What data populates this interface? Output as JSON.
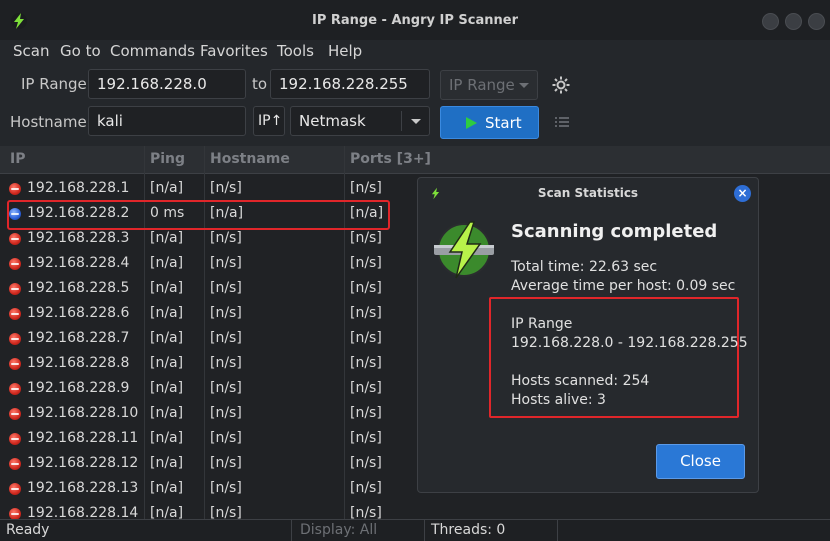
{
  "window": {
    "title": "IP Range - Angry IP Scanner"
  },
  "menu": [
    "Scan",
    "Go to",
    "Commands",
    "Favorites",
    "Tools",
    "Help"
  ],
  "toolbar": {
    "ip_range_label": "IP Range:",
    "ip_from": "192.168.228.0",
    "to_label": "to",
    "ip_to": "192.168.228.255",
    "feeder_select": "IP Range",
    "hostname_label": "Hostname:",
    "hostname": "kali",
    "ip_up_button": "IP↑",
    "netmask_select": "Netmask",
    "start_label": "Start"
  },
  "table": {
    "columns": [
      "IP",
      "Ping",
      "Hostname",
      "Ports [3+]"
    ],
    "rows": [
      {
        "status": "dead",
        "ip": "192.168.228.1",
        "ping": "[n/a]",
        "hostname": "[n/s]",
        "ports": "[n/s]"
      },
      {
        "status": "alive",
        "ip": "192.168.228.2",
        "ping": "0 ms",
        "hostname": "[n/a]",
        "ports": "[n/a]"
      },
      {
        "status": "dead",
        "ip": "192.168.228.3",
        "ping": "[n/a]",
        "hostname": "[n/s]",
        "ports": "[n/s]"
      },
      {
        "status": "dead",
        "ip": "192.168.228.4",
        "ping": "[n/a]",
        "hostname": "[n/s]",
        "ports": "[n/s]"
      },
      {
        "status": "dead",
        "ip": "192.168.228.5",
        "ping": "[n/a]",
        "hostname": "[n/s]",
        "ports": "[n/s]"
      },
      {
        "status": "dead",
        "ip": "192.168.228.6",
        "ping": "[n/a]",
        "hostname": "[n/s]",
        "ports": "[n/s]"
      },
      {
        "status": "dead",
        "ip": "192.168.228.7",
        "ping": "[n/a]",
        "hostname": "[n/s]",
        "ports": "[n/s]"
      },
      {
        "status": "dead",
        "ip": "192.168.228.8",
        "ping": "[n/a]",
        "hostname": "[n/s]",
        "ports": "[n/s]"
      },
      {
        "status": "dead",
        "ip": "192.168.228.9",
        "ping": "[n/a]",
        "hostname": "[n/s]",
        "ports": "[n/s]"
      },
      {
        "status": "dead",
        "ip": "192.168.228.10",
        "ping": "[n/a]",
        "hostname": "[n/s]",
        "ports": "[n/s]"
      },
      {
        "status": "dead",
        "ip": "192.168.228.11",
        "ping": "[n/a]",
        "hostname": "[n/s]",
        "ports": "[n/s]"
      },
      {
        "status": "dead",
        "ip": "192.168.228.12",
        "ping": "[n/a]",
        "hostname": "[n/s]",
        "ports": "[n/s]"
      },
      {
        "status": "dead",
        "ip": "192.168.228.13",
        "ping": "[n/a]",
        "hostname": "[n/s]",
        "ports": "[n/s]"
      },
      {
        "status": "dead",
        "ip": "192.168.228.14",
        "ping": "[n/a]",
        "hostname": "[n/s]",
        "ports": "[n/s]"
      }
    ]
  },
  "statusbar": {
    "status": "Ready",
    "display": "Display: All",
    "threads": "Threads: 0"
  },
  "dialog": {
    "title": "Scan Statistics",
    "heading": "Scanning completed",
    "total_time": "Total time: 22.63 sec",
    "avg_time": "Average time per host: 0.09 sec",
    "range_label": "IP Range",
    "range_value": "192.168.228.0 - 192.168.228.255",
    "hosts_scanned": "Hosts scanned: 254",
    "hosts_alive": "Hosts alive: 3",
    "close_label": "Close"
  },
  "colors": {
    "accent": "#1f6fc4",
    "highlight": "#e0262a",
    "alive": "#2b5fd9",
    "dead": "#d0281e",
    "logo_green": "#7ee03a"
  },
  "icons": {
    "app": "lightning-bolt-icon",
    "settings": "gear-icon",
    "prefs": "list-icon",
    "start": "play-icon",
    "close": "close-icon"
  }
}
